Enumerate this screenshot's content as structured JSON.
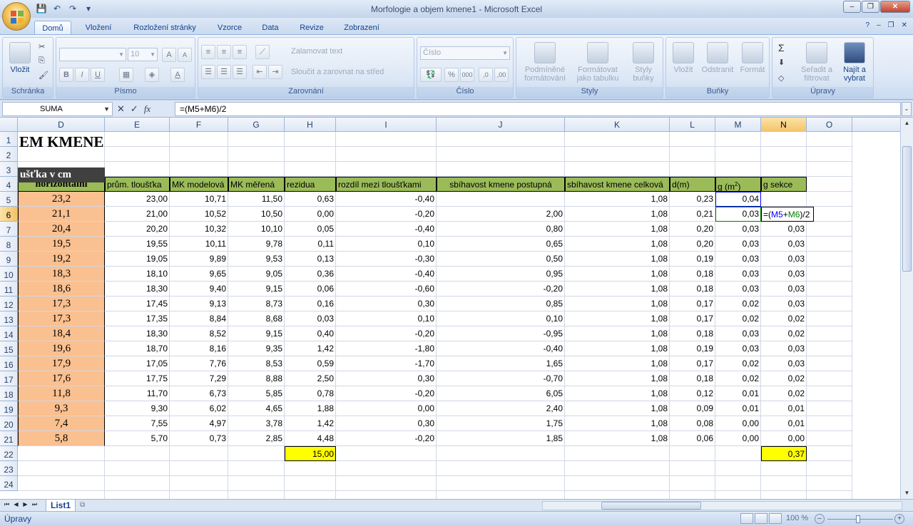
{
  "window": {
    "title": "Morfologie a objem kmene1 - Microsoft Excel",
    "min": "–",
    "max": "❐",
    "close": "✕"
  },
  "qat": {
    "save": "💾",
    "undo": "↶",
    "redo": "↷",
    "more": "▾"
  },
  "tabs": [
    "Domů",
    "Vložení",
    "Rozložení stránky",
    "Vzorce",
    "Data",
    "Revize",
    "Zobrazení"
  ],
  "active_tab": "Domů",
  "help": {
    "help": "?",
    "min": "–",
    "restore": "❐",
    "close": "✕"
  },
  "ribbon": {
    "clipboard": {
      "label": "Schránka",
      "paste": "Vložit",
      "cut": "✂",
      "copy": "⎘",
      "format_painter": "🖌"
    },
    "font": {
      "label": "Písmo",
      "font_name": "",
      "font_size": "10",
      "grow": "A",
      "shrink": "A",
      "bold": "B",
      "italic": "I",
      "underline": "U",
      "borders": "▦",
      "fill": "◈",
      "color": "A"
    },
    "alignment": {
      "label": "Zarovnání",
      "wrap": "Zalamovat text",
      "merge": "Sloučit a zarovnat na střed"
    },
    "number": {
      "label": "Číslo",
      "format": "Číslo",
      "percent": "%",
      "thousands": "000",
      "inc_dec": ",0",
      "dec_dec": ",00"
    },
    "styles": {
      "label": "Styly",
      "conditional": "Podmíněné formátování",
      "table": "Formátovat jako tabulku",
      "cell_styles": "Styly buňky"
    },
    "cells": {
      "label": "Buňky",
      "insert": "Vložit",
      "delete": "Odstranit",
      "format": "Formát"
    },
    "editing": {
      "label": "Úpravy",
      "sum": "Σ",
      "fill": "⬇",
      "clear": "◇",
      "sort": "Seřadit a filtrovat",
      "find": "Najít a vybrat"
    }
  },
  "formula_bar": {
    "name_box": "SUMA",
    "cancel": "✕",
    "enter": "✓",
    "fx": "fx",
    "formula": "=(M5+M6)/2"
  },
  "columns": [
    "D",
    "E",
    "F",
    "G",
    "H",
    "I",
    "J",
    "K",
    "L",
    "M",
    "N",
    "O"
  ],
  "rows": [
    "1",
    "2",
    "3",
    "4",
    "5",
    "6",
    "7",
    "8",
    "9",
    "10",
    "11",
    "12",
    "13",
    "14",
    "15",
    "16",
    "17",
    "18",
    "19",
    "20",
    "21",
    "22",
    "23",
    "24"
  ],
  "sheet": {
    "title": "EM KMENE",
    "label_row3": "ušťka v cm",
    "headers": [
      "horizontální",
      "prům. tloušťka",
      "MK modelová",
      "MK měřená",
      "rezidua",
      "rozdíl mezi tloušťkami",
      "sbíhavost kmene postupná",
      "sbíhavost kmene celková",
      "d(m)",
      "g (m²)",
      "g sekce"
    ],
    "headers_g_base": "g (m",
    "headers_g_sup": "2",
    "headers_g_end": ")",
    "data": [
      [
        "23,2",
        "23,00",
        "10,71",
        "11,50",
        "0,63",
        "-0,40",
        "",
        "1,08",
        "0,23",
        "0,04",
        ""
      ],
      [
        "21,1",
        "21,00",
        "10,52",
        "10,50",
        "0,00",
        "-0,20",
        "2,00",
        "1,08",
        "0,21",
        "0,03",
        ""
      ],
      [
        "20,4",
        "20,20",
        "10,32",
        "10,10",
        "0,05",
        "-0,40",
        "0,80",
        "1,08",
        "0,20",
        "0,03",
        "0,03"
      ],
      [
        "19,5",
        "19,55",
        "10,11",
        "9,78",
        "0,11",
        "0,10",
        "0,65",
        "1,08",
        "0,20",
        "0,03",
        "0,03"
      ],
      [
        "19,2",
        "19,05",
        "9,89",
        "9,53",
        "0,13",
        "-0,30",
        "0,50",
        "1,08",
        "0,19",
        "0,03",
        "0,03"
      ],
      [
        "18,3",
        "18,10",
        "9,65",
        "9,05",
        "0,36",
        "-0,40",
        "0,95",
        "1,08",
        "0,18",
        "0,03",
        "0,03"
      ],
      [
        "18,6",
        "18,30",
        "9,40",
        "9,15",
        "0,06",
        "-0,60",
        "-0,20",
        "1,08",
        "0,18",
        "0,03",
        "0,03"
      ],
      [
        "17,3",
        "17,45",
        "9,13",
        "8,73",
        "0,16",
        "0,30",
        "0,85",
        "1,08",
        "0,17",
        "0,02",
        "0,03"
      ],
      [
        "17,3",
        "17,35",
        "8,84",
        "8,68",
        "0,03",
        "0,10",
        "0,10",
        "1,08",
        "0,17",
        "0,02",
        "0,02"
      ],
      [
        "18,4",
        "18,30",
        "8,52",
        "9,15",
        "0,40",
        "-0,20",
        "-0,95",
        "1,08",
        "0,18",
        "0,03",
        "0,02"
      ],
      [
        "19,6",
        "18,70",
        "8,16",
        "9,35",
        "1,42",
        "-1,80",
        "-0,40",
        "1,08",
        "0,19",
        "0,03",
        "0,03"
      ],
      [
        "17,9",
        "17,05",
        "7,76",
        "8,53",
        "0,59",
        "-1,70",
        "1,65",
        "1,08",
        "0,17",
        "0,02",
        "0,03"
      ],
      [
        "17,6",
        "17,75",
        "7,29",
        "8,88",
        "2,50",
        "0,30",
        "-0,70",
        "1,08",
        "0,18",
        "0,02",
        "0,02"
      ],
      [
        "11,8",
        "11,70",
        "6,73",
        "5,85",
        "0,78",
        "-0,20",
        "6,05",
        "1,08",
        "0,12",
        "0,01",
        "0,02"
      ],
      [
        "9,3",
        "9,30",
        "6,02",
        "4,65",
        "1,88",
        "0,00",
        "2,40",
        "1,08",
        "0,09",
        "0,01",
        "0,01"
      ],
      [
        "7,4",
        "7,55",
        "4,97",
        "3,78",
        "1,42",
        "0,30",
        "1,75",
        "1,08",
        "0,08",
        "0,00",
        "0,01"
      ],
      [
        "5,8",
        "5,70",
        "0,73",
        "2,85",
        "4,48",
        "-0,20",
        "1,85",
        "1,08",
        "0,06",
        "0,00",
        "0,00"
      ]
    ],
    "sum_rezidua": "15,00",
    "sum_gsekce": "0,37",
    "editing_cell": {
      "eq": "=(",
      "ref1": "M5",
      "plus": "+",
      "ref2": "M6",
      "rest": ")/2"
    }
  },
  "sheet_tabs": {
    "name": "List1",
    "nav": [
      "⏮",
      "◀",
      "▶",
      "⏭"
    ]
  },
  "status": {
    "mode": "Úpravy",
    "zoom": "100 %",
    "minus": "–",
    "plus": "+"
  },
  "colors": {
    "header_green": "#9bbb59",
    "peach": "#fac090",
    "yellow": "#ffff00",
    "ref_blue": "#0000ff",
    "ref_green": "#008000"
  }
}
